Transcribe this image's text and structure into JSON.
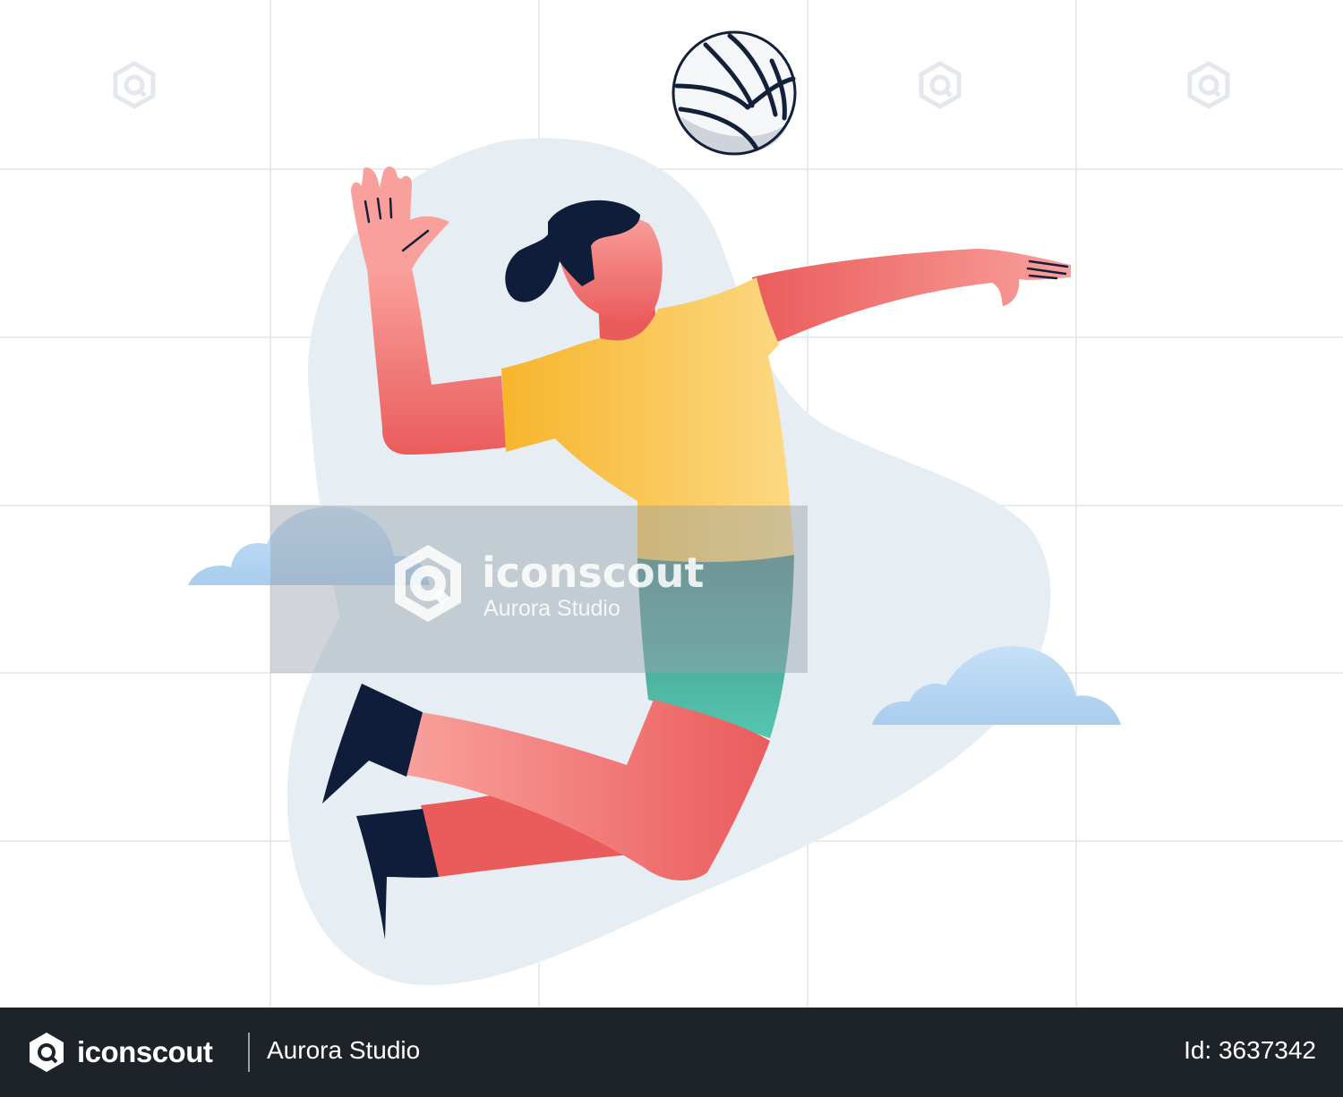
{
  "watermark": {
    "brand": "iconscout",
    "author": "Aurora Studio"
  },
  "footer": {
    "brand": "iconscout",
    "author": "Aurora Studio",
    "id_label": "Id: 3637342"
  },
  "colors": {
    "background": "#ffffff",
    "grid_line": "#dfe3e8",
    "blob": "#e6eef3",
    "cloud": "#bcd8f2",
    "skin_light": "#f9a09c",
    "skin_dark": "#ea5c5c",
    "shirt_light": "#fcd984",
    "shirt_dark": "#f7b52c",
    "shorts_top": "#4f8a85",
    "shorts_bottom": "#52c7b0",
    "hair": "#0e1d3a",
    "shoes": "#0e1d3a",
    "ball_white": "#f5f6f8",
    "ball_grey": "#cfd4da",
    "ball_lines": "#13203a",
    "footer_bg": "#1e2329"
  },
  "icons": [
    "iconscout-logo-icon",
    "watermark-hexagon-icon"
  ]
}
